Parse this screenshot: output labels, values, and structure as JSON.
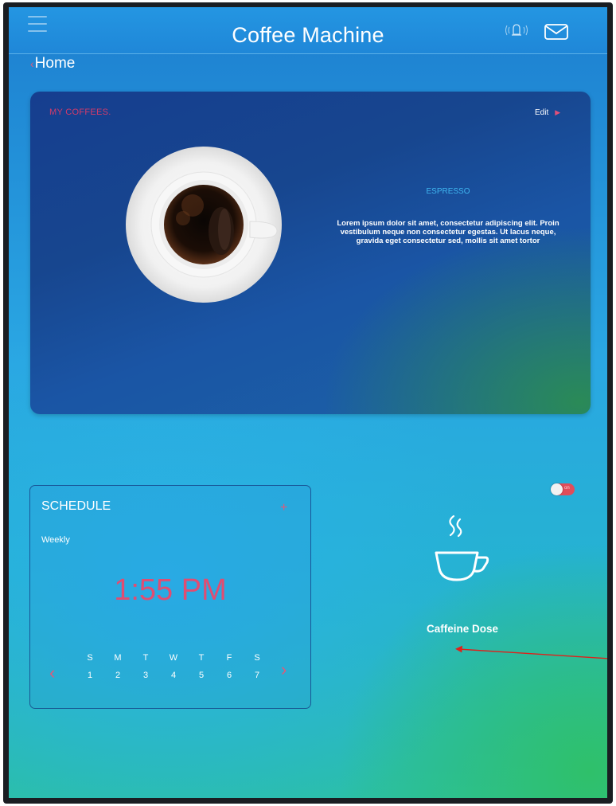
{
  "header": {
    "title": "Coffee Machine",
    "menu_icon": "hamburger-menu-icon",
    "notification_icon": "bell-icon",
    "message_icon": "mail-icon"
  },
  "breadcrumb": {
    "label": "Home",
    "icon": "chevron-left-icon"
  },
  "my_coffees": {
    "title": "MY COFFEES.",
    "edit_label": "Edit",
    "coffee_name": "ESPRESSO",
    "description": "Lorem ipsum dolor sit amet, consectetur adipiscing elit. Proin vestibulum neque non consectetur egestas. Ut lacus neque, gravida eget consectetur sed, mollis sit amet tortor"
  },
  "schedule": {
    "title": "SCHEDULE",
    "add_icon": "plus-icon",
    "frequency": "Weekly",
    "time": "1:55 PM",
    "days": [
      {
        "letter": "S",
        "num": "1"
      },
      {
        "letter": "M",
        "num": "2"
      },
      {
        "letter": "T",
        "num": "3"
      },
      {
        "letter": "W",
        "num": "4"
      },
      {
        "letter": "T",
        "num": "5"
      },
      {
        "letter": "F",
        "num": "6"
      },
      {
        "letter": "S",
        "num": "7"
      }
    ]
  },
  "caffeine": {
    "label": "Caffeine Dose",
    "icon": "coffee-cup-icon",
    "toggle_label": "on"
  },
  "colors": {
    "accent": "#e04d72",
    "header_bg": "#1f87d8",
    "card_bg": "#163e8f",
    "text": "#ffffff"
  }
}
